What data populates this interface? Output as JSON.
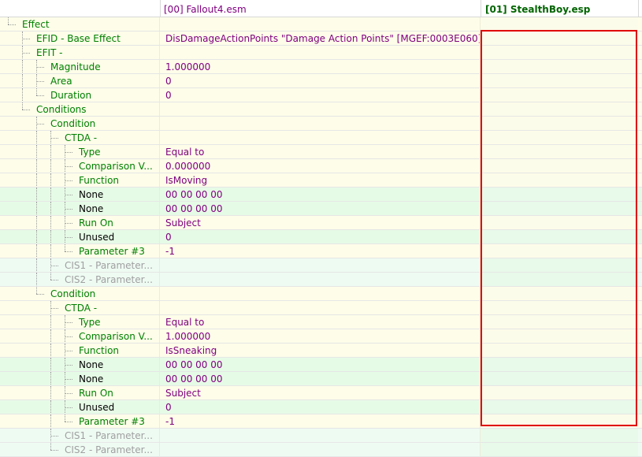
{
  "header": {
    "col0": "",
    "col1": "[00] Fallout4.esm",
    "col2": "[01] StealthBoy.esp"
  },
  "rows": [
    {
      "label": "Effect",
      "value": ""
    },
    {
      "label": "EFID - Base Effect",
      "value": "DisDamageActionPoints \"Damage Action Points\" [MGEF:0003E060]"
    },
    {
      "label": "EFIT -",
      "value": ""
    },
    {
      "label": "Magnitude",
      "value": "1.000000"
    },
    {
      "label": "Area",
      "value": "0"
    },
    {
      "label": "Duration",
      "value": "0"
    },
    {
      "label": "Conditions",
      "value": ""
    },
    {
      "label": "Condition",
      "value": ""
    },
    {
      "label": "CTDA -",
      "value": ""
    },
    {
      "label": "Type",
      "value": "Equal to"
    },
    {
      "label": "Comparison V...",
      "value": "0.000000"
    },
    {
      "label": "Function",
      "value": "IsMoving"
    },
    {
      "label": "None",
      "value": "00 00 00 00"
    },
    {
      "label": "None",
      "value": "00 00 00 00"
    },
    {
      "label": "Run On",
      "value": "Subject"
    },
    {
      "label": "Unused",
      "value": "0"
    },
    {
      "label": "Parameter #3",
      "value": "-1"
    },
    {
      "label": "CIS1 - Parameter...",
      "value": ""
    },
    {
      "label": "CIS2 - Parameter...",
      "value": ""
    },
    {
      "label": "Condition",
      "value": ""
    },
    {
      "label": "CTDA -",
      "value": ""
    },
    {
      "label": "Type",
      "value": "Equal to"
    },
    {
      "label": "Comparison V...",
      "value": "1.000000"
    },
    {
      "label": "Function",
      "value": "IsSneaking"
    },
    {
      "label": "None",
      "value": "00 00 00 00"
    },
    {
      "label": "None",
      "value": "00 00 00 00"
    },
    {
      "label": "Run On",
      "value": "Subject"
    },
    {
      "label": "Unused",
      "value": "0"
    },
    {
      "label": "Parameter #3",
      "value": "-1"
    },
    {
      "label": "CIS1 - Parameter...",
      "value": ""
    },
    {
      "label": "CIS2 - Parameter...",
      "value": ""
    }
  ],
  "colors": {
    "label_green": "#008000",
    "value_purple": "#800080",
    "plugin_header_green": "#006400",
    "highlight_border": "#e00000",
    "row_yellow": "#fdfde9",
    "row_green": "#e6fbe6"
  }
}
